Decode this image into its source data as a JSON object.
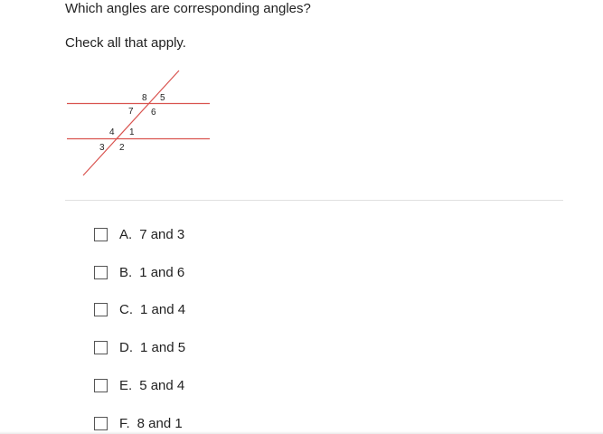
{
  "question": {
    "prompt": "Which angles are corresponding angles?",
    "instruction": "Check all that apply."
  },
  "diagram": {
    "line_color": "#d9534f",
    "transversal_color": "#d9534f",
    "angle_labels": [
      "8",
      "5",
      "7",
      "6",
      "4",
      "1",
      "3",
      "2"
    ]
  },
  "options": [
    {
      "letter": "A.",
      "text": "7 and 3",
      "checked": false
    },
    {
      "letter": "B.",
      "text": "1 and 6",
      "checked": false
    },
    {
      "letter": "C.",
      "text": "1 and 4",
      "checked": false
    },
    {
      "letter": "D.",
      "text": "1 and 5",
      "checked": false
    },
    {
      "letter": "E.",
      "text": "5 and 4",
      "checked": false
    },
    {
      "letter": "F.",
      "text": "8 and 1",
      "checked": false
    }
  ]
}
